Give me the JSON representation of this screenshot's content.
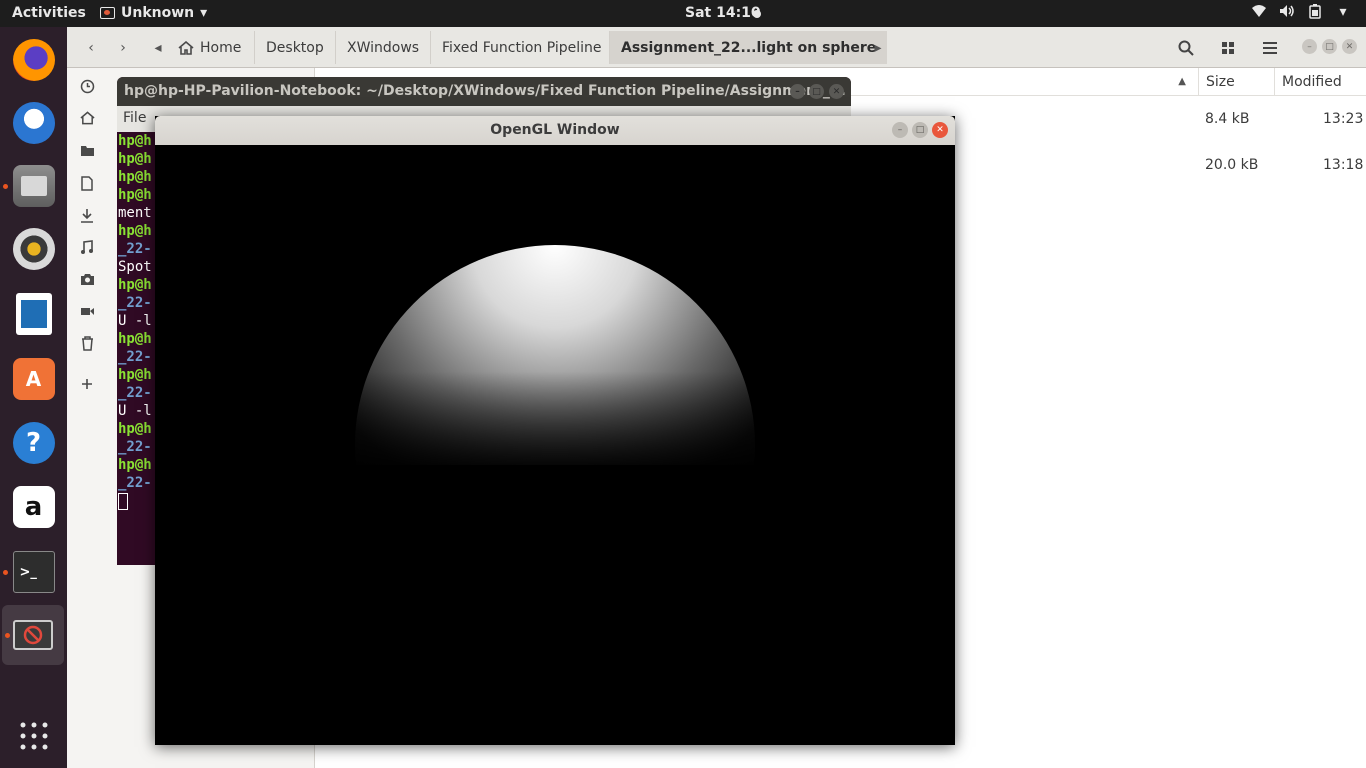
{
  "topbar": {
    "activities": "Activities",
    "app_menu": "Unknown",
    "clock": "Sat 14:10",
    "tray_icons": [
      "wifi-icon",
      "volume-icon",
      "battery-icon",
      "system-menu-chevron-icon"
    ]
  },
  "dock": {
    "items": [
      "firefox",
      "thunderbird",
      "files",
      "rhythmbox",
      "libreoffice-writer",
      "ubuntu-software",
      "help",
      "amazon",
      "terminal",
      "opengl-app"
    ],
    "show_apps_icon": "grid-icon"
  },
  "file_manager": {
    "back_icon": "‹",
    "forward_icon": "›",
    "crumb_prev_icon": "◂",
    "crumb_next_icon": "▸",
    "breadcrumbs": [
      {
        "label": "Home"
      },
      {
        "label": "Desktop"
      },
      {
        "label": "XWindows"
      },
      {
        "label": "Fixed Function Pipeline"
      },
      {
        "label": "Assignment_22...light on sphere"
      }
    ],
    "columns": {
      "size": "Size",
      "modified": "Modified"
    },
    "rows": [
      {
        "size": "8.4 kB",
        "modified": "13:23"
      },
      {
        "size": "20.0 kB",
        "modified": "13:18"
      }
    ],
    "accent": "#e95420"
  },
  "terminal": {
    "title": "hp@hp-HP-Pavilion-Notebook: ~/Desktop/XWindows/Fixed Function Pipeline/Assignment_...",
    "menu_first": "File",
    "lines": [
      {
        "text": "hp@h",
        "color": "green"
      },
      {
        "text": "hp@h",
        "color": "green"
      },
      {
        "text": "hp@h",
        "color": "green"
      },
      {
        "text": "hp@h",
        "color": "green"
      },
      {
        "text": "ment",
        "color": "white"
      },
      {
        "text": "hp@h",
        "color": "green"
      },
      {
        "text": "_22-",
        "color": "blue"
      },
      {
        "text": "Spot",
        "color": "white"
      },
      {
        "text": "hp@h",
        "color": "green"
      },
      {
        "text": "_22-",
        "color": "blue"
      },
      {
        "text": "U -l",
        "color": "white"
      },
      {
        "text": "hp@h",
        "color": "green"
      },
      {
        "text": "_22-",
        "color": "blue"
      },
      {
        "text": "hp@h",
        "color": "green"
      },
      {
        "text": "_22-",
        "color": "blue"
      },
      {
        "text": "U -l",
        "color": "white"
      },
      {
        "text": "hp@h",
        "color": "green"
      },
      {
        "text": "_22-",
        "color": "blue"
      },
      {
        "text": "hp@h",
        "color": "green"
      },
      {
        "text": "_22-",
        "color": "blue"
      }
    ],
    "background": "#300a24"
  },
  "opengl_window": {
    "title": "OpenGL Window",
    "scene": "spot-lit-sphere"
  }
}
